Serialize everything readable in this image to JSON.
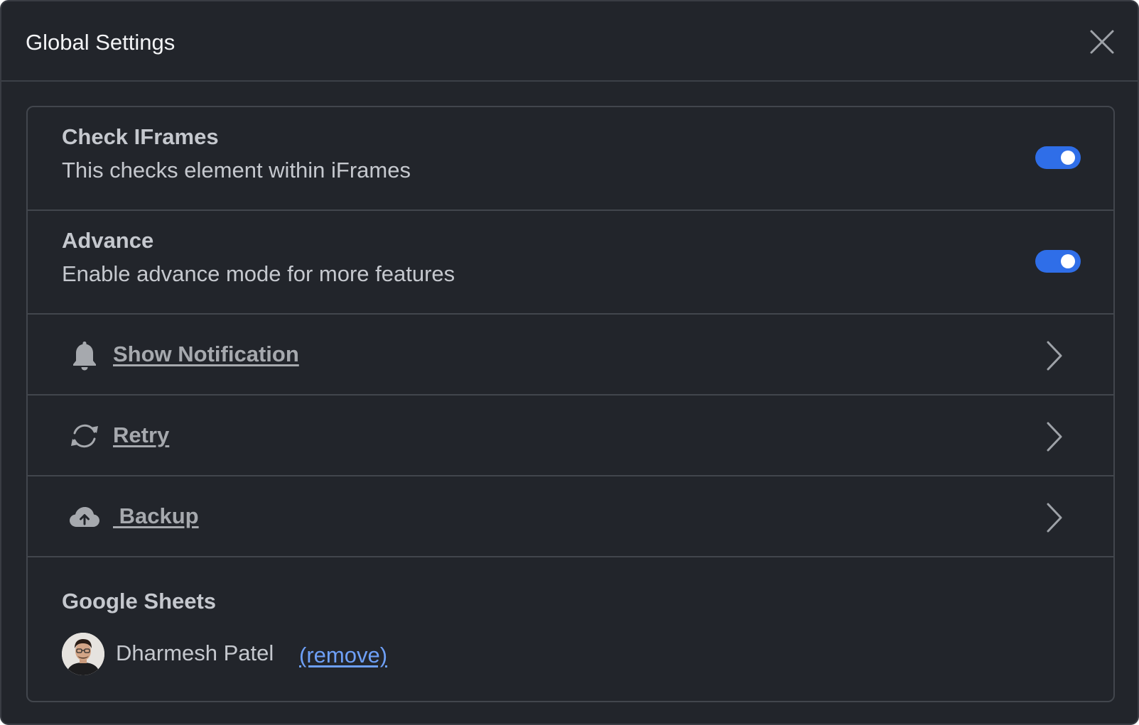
{
  "dialog": {
    "title": "Global Settings",
    "close_icon": "close-icon"
  },
  "settings": {
    "check_iframes": {
      "title": "Check IFrames",
      "description": "This checks element within iFrames",
      "enabled": true
    },
    "advance": {
      "title": "Advance",
      "description": "Enable advance mode for more features",
      "enabled": true
    }
  },
  "links": [
    {
      "label": "Show Notification",
      "icon": "bell-icon"
    },
    {
      "label": "Retry",
      "icon": "refresh-icon"
    },
    {
      "label": " Backup",
      "icon": "cloud-upload-icon"
    }
  ],
  "google_sheets": {
    "title": "Google Sheets",
    "user_name": "Dharmesh Patel",
    "remove_label": "(remove)"
  },
  "colors": {
    "background": "#22252b",
    "toggle_on": "#2f6ee8",
    "link": "#6ea0f7"
  }
}
